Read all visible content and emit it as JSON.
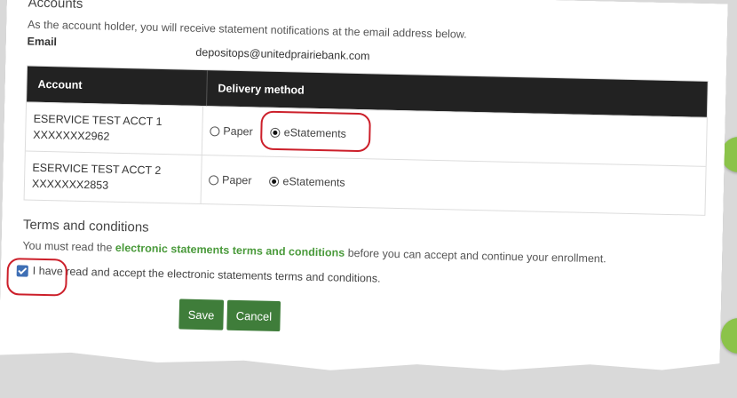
{
  "section": {
    "title": "Accounts",
    "notice": "As the account holder, you will receive statement notifications at the email address below.",
    "email_label": "Email",
    "email_value": "depositops@unitedprairiebank.com"
  },
  "table": {
    "headers": [
      "Account",
      "Delivery method"
    ],
    "rows": [
      {
        "name": "ESERVICE TEST ACCT 1",
        "number": "XXXXXXX2962",
        "paper_label": "Paper",
        "estatements_label": "eStatements",
        "selected": "eStatements"
      },
      {
        "name": "ESERVICE TEST ACCT 2",
        "number": "XXXXXXX2853",
        "paper_label": "Paper",
        "estatements_label": "eStatements",
        "selected": "eStatements"
      }
    ]
  },
  "terms": {
    "title": "Terms and conditions",
    "text_before": "You must read the ",
    "link": "electronic statements terms and conditions",
    "text_after": " before you can accept and continue your enrollment.",
    "accept_label": "I have read and accept the electronic statements terms and conditions.",
    "accepted": true
  },
  "buttons": {
    "save": "Save",
    "cancel": "Cancel"
  },
  "colors": {
    "button": "#3f7d3a",
    "link": "#4a9a3b",
    "header_bg": "#222222",
    "annotation": "#cc1f2a",
    "side_dot": "#8bc34a"
  }
}
